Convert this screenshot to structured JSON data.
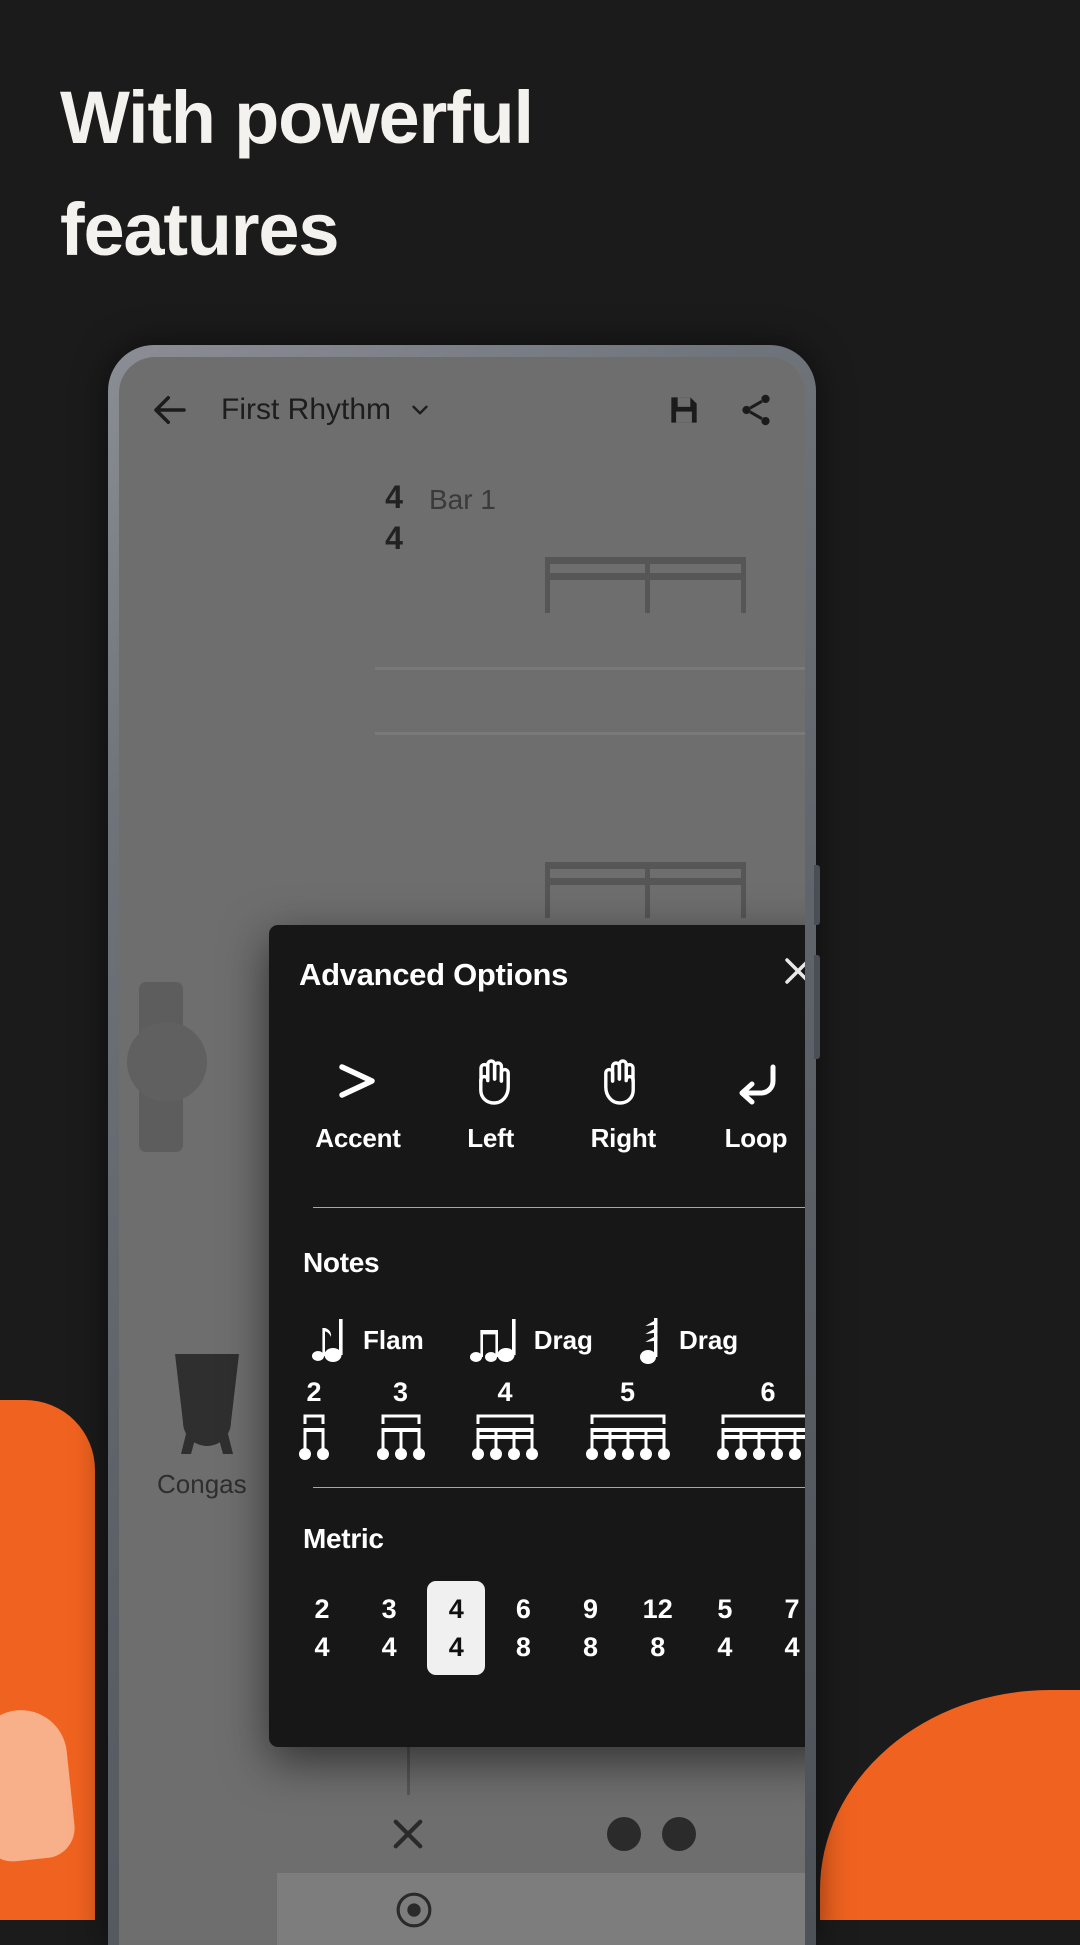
{
  "headline": {
    "line1": "With powerful",
    "line2": "features"
  },
  "colors": {
    "background": "#1b1b1b",
    "accent_orange": "#f0621f",
    "dialog_bg": "#171717",
    "phone_screen": "#6e6e6e",
    "selected_chip": "#f0f0f0"
  },
  "app": {
    "appbar": {
      "back_icon": "arrow-left-icon",
      "title": "First Rhythm",
      "chevron_icon": "chevron-down-icon",
      "save_icon": "save-icon",
      "share_icon": "share-icon"
    },
    "score": {
      "time_signature_top": "4",
      "time_signature_bottom": "4",
      "bar_label": "Bar 1",
      "instrument_label": "Congas"
    },
    "transport": {
      "clear_icon": "x-icon",
      "record_icon": "record-icon"
    }
  },
  "dialog": {
    "title": "Advanced Options",
    "close_icon": "close-icon",
    "tools": [
      {
        "label": "Accent",
        "icon": "accent-chevron-icon"
      },
      {
        "label": "Left",
        "icon": "left-hand-icon"
      },
      {
        "label": "Right",
        "icon": "right-hand-icon"
      },
      {
        "label": "Loop",
        "icon": "loop-arrow-icon"
      }
    ],
    "notes": {
      "title": "Notes",
      "ornaments": [
        {
          "label": "Flam",
          "icon": "flam-note-icon",
          "grace_count": 1
        },
        {
          "label": "Drag",
          "icon": "drag-note-icon",
          "grace_count": 2
        },
        {
          "label": "Drag",
          "icon": "buzz-note-icon",
          "grace_count": 3
        }
      ],
      "tuplets": [
        {
          "number": "2",
          "notes": 2,
          "beams": 1
        },
        {
          "number": "3",
          "notes": 3,
          "beams": 1
        },
        {
          "number": "4",
          "notes": 4,
          "beams": 2
        },
        {
          "number": "5",
          "notes": 5,
          "beams": 2
        },
        {
          "number": "6",
          "notes": 6,
          "beams": 2
        }
      ]
    },
    "metric": {
      "title": "Metric",
      "options": [
        {
          "top": "2",
          "bottom": "4",
          "selected": false
        },
        {
          "top": "3",
          "bottom": "4",
          "selected": false
        },
        {
          "top": "4",
          "bottom": "4",
          "selected": true
        },
        {
          "top": "6",
          "bottom": "8",
          "selected": false
        },
        {
          "top": "9",
          "bottom": "8",
          "selected": false
        },
        {
          "top": "12",
          "bottom": "8",
          "selected": false
        },
        {
          "top": "5",
          "bottom": "4",
          "selected": false
        },
        {
          "top": "7",
          "bottom": "4",
          "selected": false
        }
      ]
    }
  }
}
